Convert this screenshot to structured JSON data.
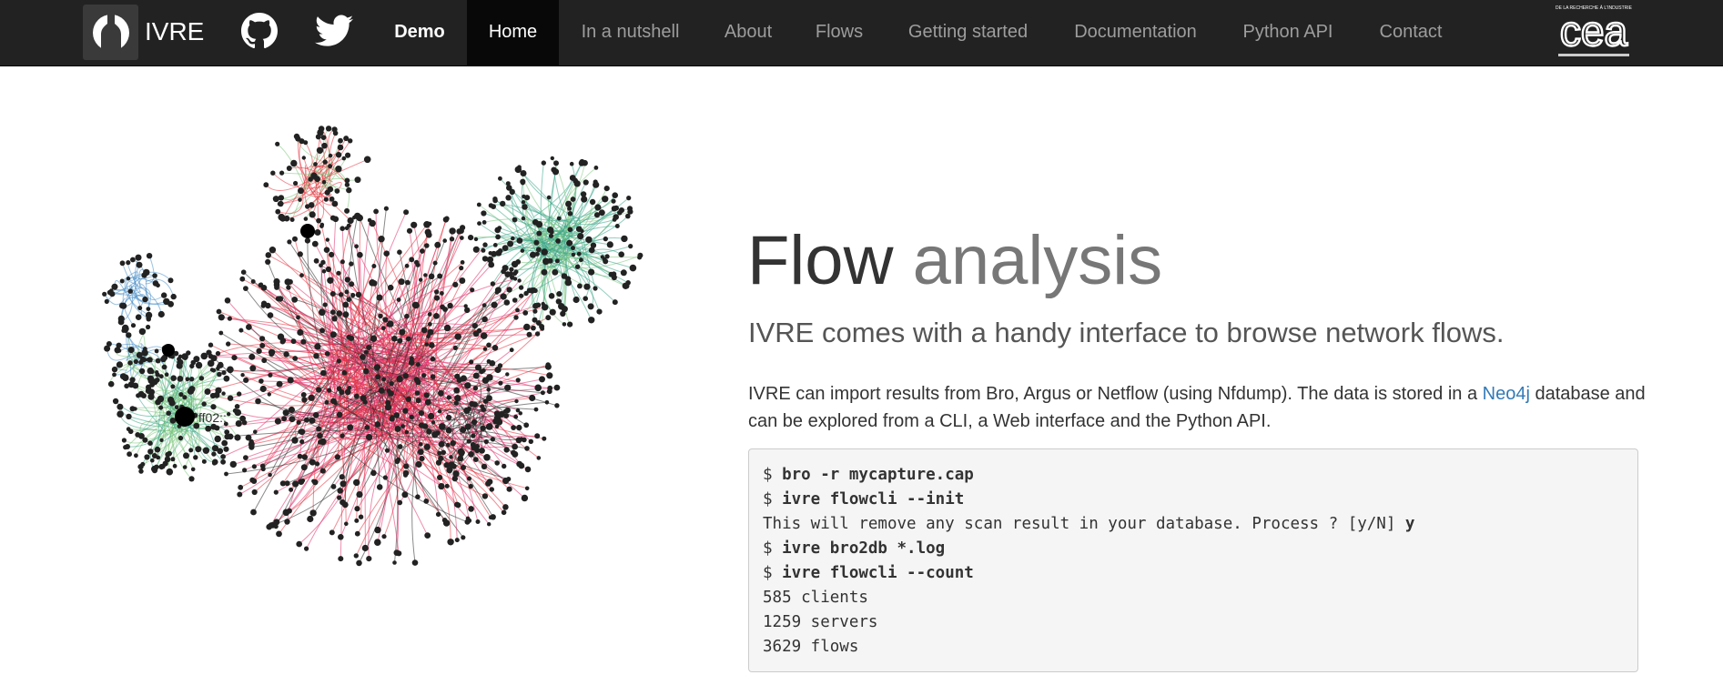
{
  "navbar": {
    "brand": "IVRE",
    "social": [
      "github-icon",
      "twitter-icon"
    ],
    "items": [
      {
        "label": "Demo"
      },
      {
        "label": "Home"
      },
      {
        "label": "In a nutshell"
      },
      {
        "label": "About"
      },
      {
        "label": "Flows"
      },
      {
        "label": "Getting started"
      },
      {
        "label": "Documentation"
      },
      {
        "label": "Python API"
      },
      {
        "label": "Contact"
      }
    ],
    "partner_logo": {
      "word": "cea",
      "tagline": "DE LA RECHERCHE À L'INDUSTRIE"
    },
    "active": "Home",
    "colors": {
      "bg": "#222222",
      "active_bg": "#080808",
      "text": "#9d9d9d"
    }
  },
  "graph": {
    "node_label": "ff02::",
    "cluster_colors": [
      "#e8303c",
      "#e0306e",
      "#3aa589",
      "#7fc97f",
      "#4a90c8",
      "#2a2a2a"
    ]
  },
  "hero": {
    "title_main": "Flow",
    "title_light": "analysis",
    "subtitle": "IVRE comes with a handy interface to browse network flows.",
    "para_before": "IVRE can import results from Bro, Argus or Netflow (using Nfdump). The data is stored in a ",
    "para_link": "Neo4j",
    "para_after": " database and can be explored from a CLI, a Web interface and the Python API."
  },
  "code": {
    "lines": [
      {
        "prompt": "$ ",
        "cmd": "bro -r mycapture.cap",
        "out": ""
      },
      {
        "prompt": "$ ",
        "cmd": "ivre flowcli --init",
        "out": ""
      },
      {
        "prompt": "",
        "cmd": "",
        "out": "This will remove any scan result in your database. Process ? [y/N] ",
        "answer": "y"
      },
      {
        "prompt": "$ ",
        "cmd": "ivre bro2db *.log",
        "out": ""
      },
      {
        "prompt": "$ ",
        "cmd": "ivre flowcli --count",
        "out": ""
      },
      {
        "prompt": "",
        "cmd": "",
        "out": "585 clients"
      },
      {
        "prompt": "",
        "cmd": "",
        "out": "1259 servers"
      },
      {
        "prompt": "",
        "cmd": "",
        "out": "3629 flows"
      }
    ]
  }
}
